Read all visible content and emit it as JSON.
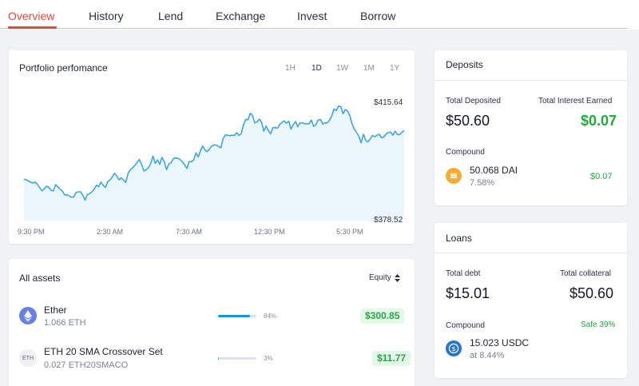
{
  "nav": {
    "tabs": [
      "Overview",
      "History",
      "Lend",
      "Exchange",
      "Invest",
      "Borrow"
    ],
    "active": "Overview"
  },
  "portfolio": {
    "title": "Portfolio perfomance",
    "ranges": [
      "1H",
      "1D",
      "1W",
      "1M",
      "1Y"
    ],
    "active_range": "1D",
    "high_label": "$415.64",
    "low_label": "$378.52",
    "x_ticks": [
      "9:30 PM",
      "2:30 AM",
      "7:30 AM",
      "12:30 PM",
      "5:30 PM"
    ],
    "chart_data": {
      "type": "area",
      "xlabel": "",
      "ylabel": "",
      "ymin": 378.52,
      "ymax": 415.64,
      "series": [
        {
          "values": [
            391.6,
            391.4,
            391.0,
            390.6,
            390.4,
            390.7,
            389.9,
            388.9,
            387.9,
            388.6,
            389.4,
            389.0,
            388.1,
            387.9,
            389.9,
            389.2,
            388.4,
            387.8,
            386.6,
            386.7,
            386.3,
            385.9,
            386.0,
            387.4,
            387.6,
            387.6,
            386.5,
            385.0,
            386.7,
            387.0,
            387.6,
            388.4,
            389.7,
            389.2,
            390.7,
            389.7,
            389.0,
            390.8,
            391.4,
            392.2,
            393.5,
            392.6,
            391.4,
            392.0,
            391.3,
            390.6,
            393.4,
            394.6,
            395.2,
            395.9,
            397.0,
            397.8,
            396.3,
            394.2,
            394.6,
            395.2,
            396.5,
            398.9,
            396.6,
            397.7,
            396.3,
            398.5,
            397.1,
            394.6,
            396.4,
            396.8,
            398.1,
            398.3,
            398.2,
            397.8,
            397.1,
            396.1,
            395.0,
            397.2,
            397.1,
            397.7,
            399.9,
            398.6,
            400.6,
            402.1,
            400.8,
            400.3,
            401.2,
            402.1,
            402.4,
            402.4,
            401.9,
            401.5,
            404.4,
            405.6,
            405.5,
            405.3,
            405.5,
            405.4,
            406.3,
            405.4,
            406.0,
            408.8,
            410.5,
            410.4,
            412.4,
            411.7,
            409.4,
            409.7,
            410.6,
            409.6,
            406.8,
            408.4,
            407.0,
            405.9,
            407.9,
            407.9,
            407.7,
            408.9,
            409.5,
            410.0,
            409.3,
            409.9,
            407.4,
            408.8,
            409.8,
            408.2,
            409.4,
            409.4,
            409.1,
            409.1,
            409.1,
            410.3,
            408.3,
            408.9,
            410.3,
            410.5,
            409.0,
            409.4,
            409.4,
            410.2,
            411.6,
            413.8,
            413.3,
            414.7,
            414.5,
            412.3,
            413.6,
            413.1,
            411.7,
            409.0,
            407.4,
            406.3,
            405.2,
            403.1,
            405.8,
            403.9,
            403.4,
            404.3,
            405.4,
            405.0,
            405.5,
            405.8,
            404.7,
            404.9,
            405.9,
            406.3,
            406.5,
            405.5,
            406.8,
            405.7,
            405.7,
            406.4,
            407.0
          ],
          "color": "#3ba6ea"
        }
      ]
    }
  },
  "assets": {
    "title": "All assets",
    "sort_label": "Equity",
    "rows": [
      {
        "name": "Ether",
        "amount": "1.066 ETH",
        "pct_label": "84%",
        "pct": 84,
        "value": "$300.85"
      },
      {
        "name": "ETH 20 SMA Crossover Set",
        "amount": "0.027 ETH20SMACO",
        "pct_label": "3%",
        "pct": 3,
        "value": "$11.77",
        "icon_text": "ETH"
      }
    ]
  },
  "deposits": {
    "title": "Deposits",
    "total_label": "Total Deposited",
    "total_value": "$50.60",
    "interest_label": "Total Interest Earned",
    "interest_value": "$0.07",
    "protocol": "Compound",
    "token_amount": "50.068 DAI",
    "token_rate": "7.58%",
    "token_interest": "$0.07"
  },
  "loans": {
    "title": "Loans",
    "debt_label": "Total debt",
    "debt_value": "$15.01",
    "collateral_label": "Total collateral",
    "collateral_value": "$50.60",
    "protocol": "Compound",
    "status": "Safe 39%",
    "token_amount": "15.023 USDC",
    "token_rate": "at 8.44%"
  }
}
